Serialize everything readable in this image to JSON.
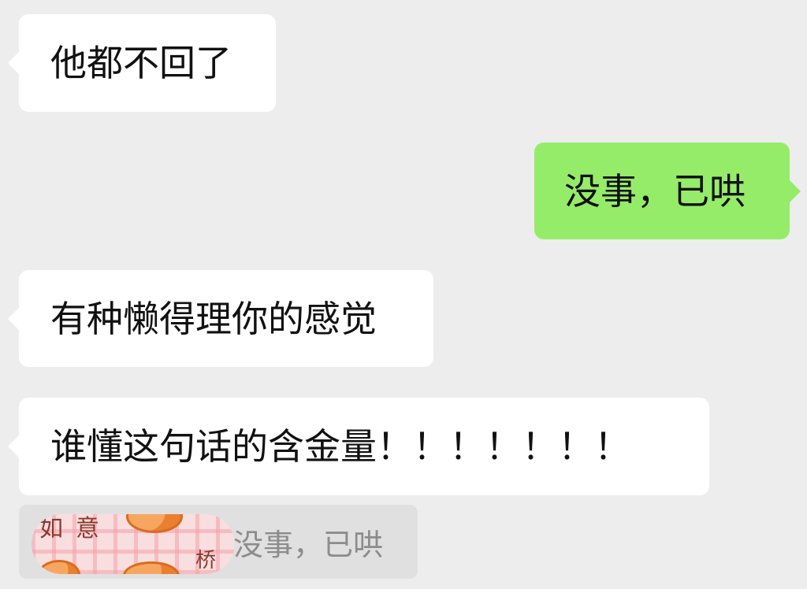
{
  "messages": [
    {
      "side": "left",
      "text": "他都不回了"
    },
    {
      "side": "right",
      "text": "没事，已哄"
    },
    {
      "side": "left",
      "text": "有种懒得理你的感觉"
    },
    {
      "side": "left",
      "text": "谁懂这句话的含金量！！！！！！！"
    }
  ],
  "quote": {
    "text": "没事，已哄",
    "thumbnail_chars": [
      "如",
      "意",
      "桥"
    ]
  },
  "colors": {
    "background": "#ededed",
    "received_bubble": "#ffffff",
    "sent_bubble": "#95ec69",
    "quote_background": "#e0e0e0",
    "quote_text": "#8c8c8c"
  }
}
